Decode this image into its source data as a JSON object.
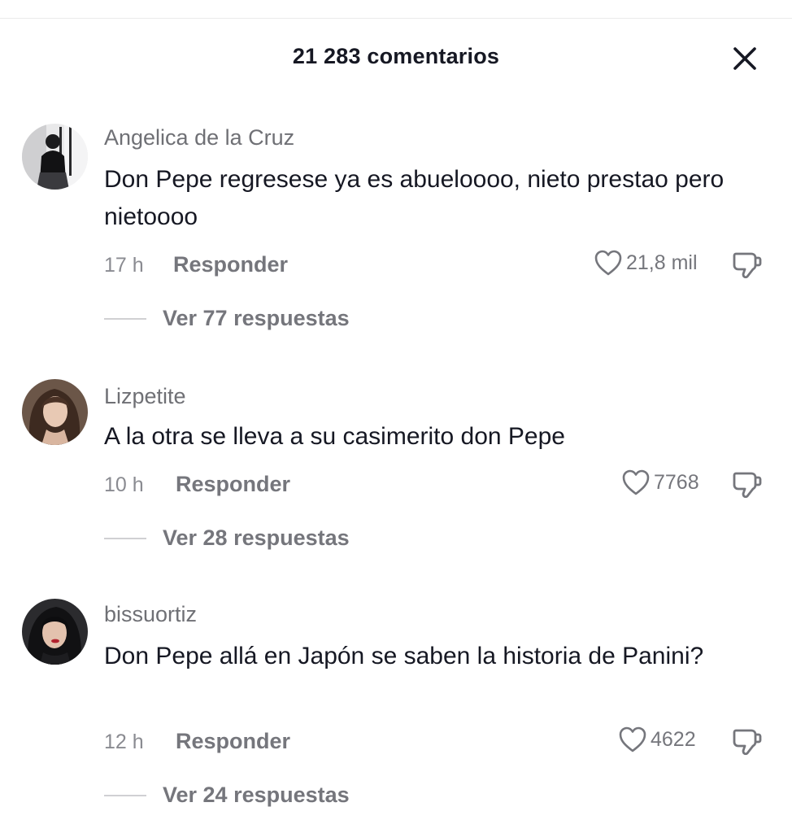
{
  "header": {
    "title": "21 283 comentarios",
    "close_icon": "close-icon"
  },
  "comments": [
    {
      "username": "Angelica de la Cruz",
      "text": "Don Pepe regresese ya es abueloooo, nieto prestao pero nietoooo",
      "time": "17 h",
      "reply_label": "Responder",
      "likes": "21,8 mil",
      "view_replies": "Ver 77 respuestas",
      "avatar_icon": "user-avatar"
    },
    {
      "username": "Lizpetite",
      "text": "A la otra se lleva a su casimerito don Pepe",
      "time": "10 h",
      "reply_label": "Responder",
      "likes": "7768",
      "view_replies": "Ver 28 respuestas",
      "avatar_icon": "user-avatar"
    },
    {
      "username": "bissuortiz",
      "text": "Don Pepe allá en Japón se saben la historia de Panini?",
      "time": "12 h",
      "reply_label": "Responder",
      "likes": "4622",
      "view_replies": "Ver 24 respuestas",
      "avatar_icon": "user-avatar"
    }
  ],
  "icons": {
    "like": "heart-icon",
    "dislike": "thumbs-down-icon"
  },
  "colors": {
    "text_primary": "#161823",
    "text_secondary": "#75767c",
    "divider": "#d0d0d3"
  }
}
